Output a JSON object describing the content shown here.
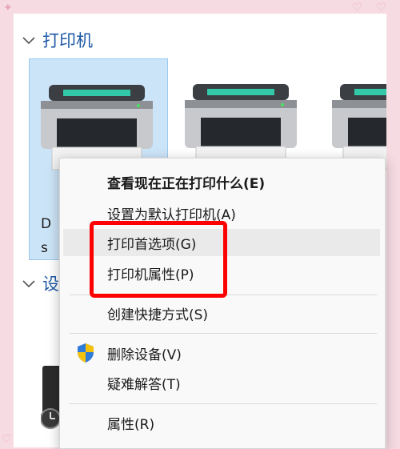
{
  "groups": {
    "printers_header": "打印机",
    "devices_header": "设"
  },
  "printers": [
    {
      "label_line1": "D",
      "label_line2": "s",
      "selected": true
    },
    {
      "label_line1": "",
      "label_line2": "",
      "selected": false
    },
    {
      "label_line1": "",
      "label_line2": "",
      "selected": false
    }
  ],
  "context_menu": {
    "items": [
      {
        "label": "查看现在正在打印什么(E)",
        "bold": true
      },
      {
        "label": "设置为默认打印机(A)"
      },
      {
        "label": "打印首选项(G)"
      },
      {
        "label": "打印机属性(P)"
      },
      {
        "label": "创建快捷方式(S)"
      },
      {
        "label": "删除设备(V)",
        "icon": "uac-shield-icon"
      },
      {
        "label": "疑难解答(T)"
      },
      {
        "label": "属性(R)"
      }
    ]
  },
  "colors": {
    "header_blue": "#1f5aa6",
    "selection": "#cce4f7",
    "highlight_red": "#ff0000",
    "frame_pink": "#f7dbe3"
  }
}
